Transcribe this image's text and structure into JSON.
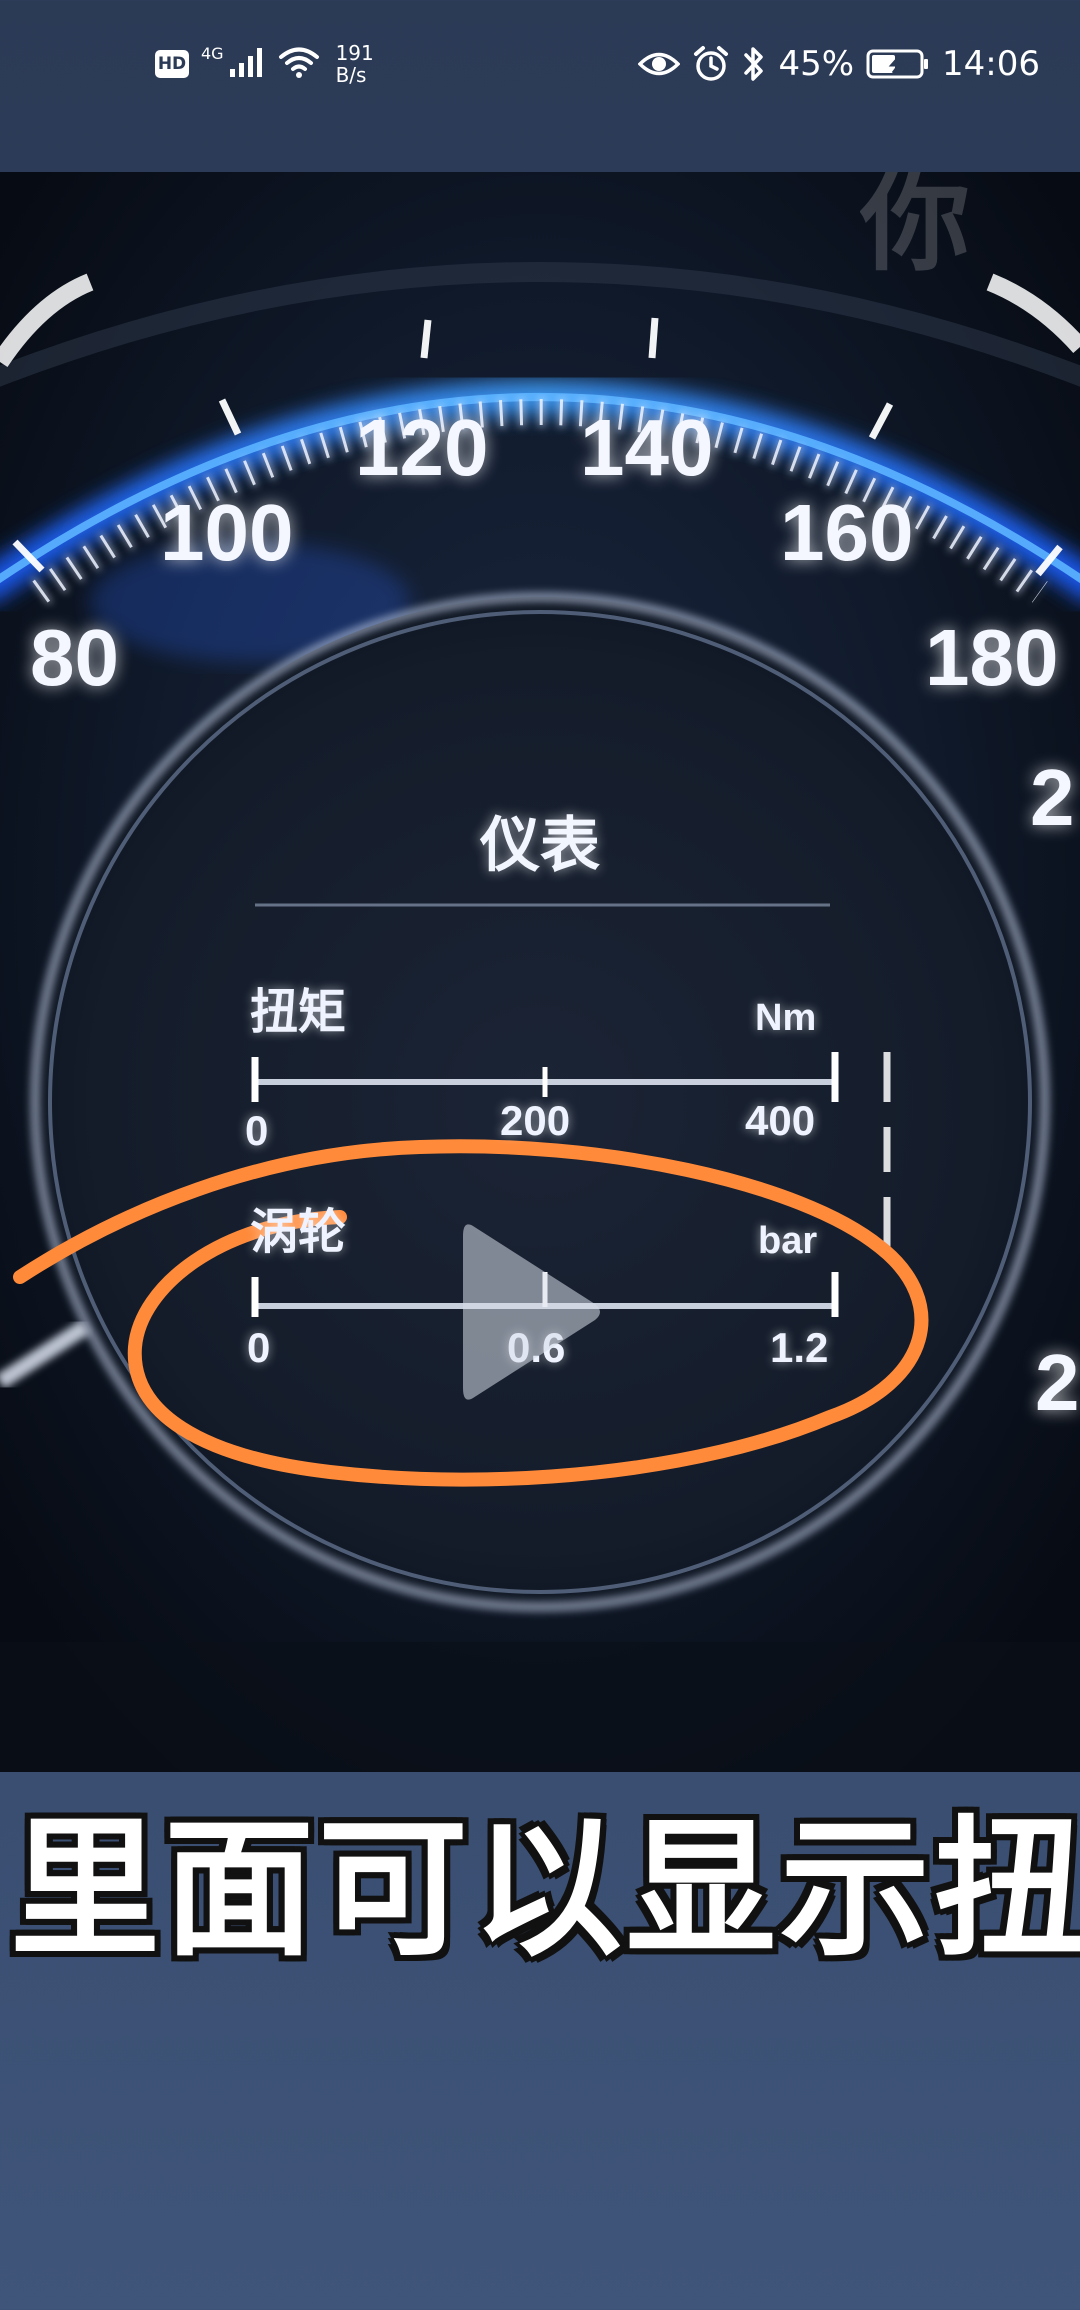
{
  "status_bar": {
    "hd_badge": "HD",
    "network_generation": "4G",
    "speed_value": "191",
    "speed_unit": "B/s",
    "battery": "45%",
    "time": "14:06",
    "icons": [
      "hd-icon",
      "signal-icon",
      "wifi-icon",
      "eye-icon",
      "alarm-icon",
      "bluetooth-icon",
      "battery-icon"
    ]
  },
  "video": {
    "speed_scale": [
      "80",
      "100",
      "120",
      "140",
      "160",
      "180",
      "2",
      "2"
    ],
    "panel_title": "仪表",
    "torque_gauge": {
      "label": "扭矩",
      "unit": "Nm",
      "ticks": [
        "0",
        "200",
        "400"
      ]
    },
    "boost_gauge": {
      "label": "涡轮",
      "unit": "bar",
      "ticks": [
        "0",
        "0.6",
        "1.2"
      ]
    },
    "annotation_color": "#ff8a3a",
    "overlay_corner_text": "你"
  },
  "subtitle": "里面可以显示扭矩"
}
